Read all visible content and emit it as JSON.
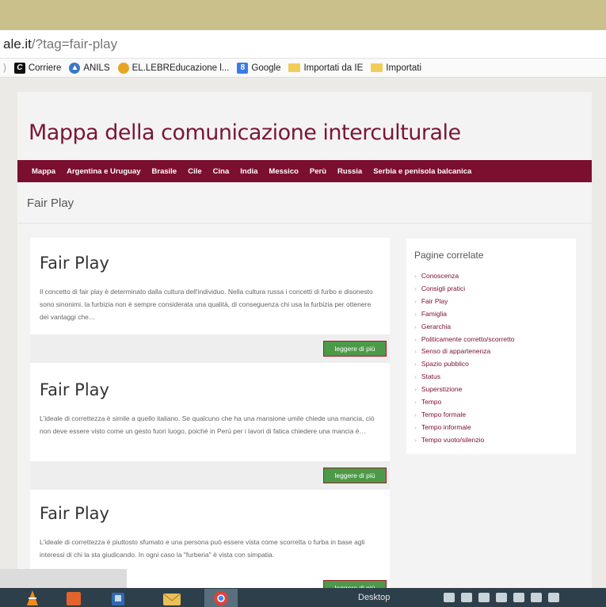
{
  "browser": {
    "url_host": "ale.it",
    "url_rest": "/?tag=fair-play",
    "bookmarks": [
      {
        "label": "Corriere",
        "icon": "corriere-icon"
      },
      {
        "label": "ANILS",
        "icon": "anils-icon"
      },
      {
        "label": "EL.LEBREducazione l...",
        "icon": "globe-icon"
      },
      {
        "label": "Google",
        "icon": "google-icon"
      },
      {
        "label": "Importati da IE",
        "icon": "folder-icon"
      },
      {
        "label": "Importati",
        "icon": "folder-icon"
      }
    ]
  },
  "site": {
    "title": "Mappa della comunicazione interculturale",
    "nav": [
      "Mappa",
      "Argentina e Uruguay",
      "Brasile",
      "Cile",
      "Cina",
      "India",
      "Messico",
      "Perù",
      "Russia",
      "Serbia e penisola balcanica"
    ],
    "breadcrumb": "Fair Play"
  },
  "posts": [
    {
      "title": "Fair Play",
      "excerpt": "Il concetto di fair play è determinato dalla cultura dell'individuo. Nella cultura russa i concetti di furbo e disonesto sono sinonimi. la furbizia non è sempre considerata una qualità, di conseguenza chi usa la furbizia per ottenere dei vantaggi che…",
      "button": "leggere di più"
    },
    {
      "title": "Fair Play",
      "excerpt": "L'ideale di correttezza è simile a quello italiano. Se qualcuno che ha una mansione umile chiede una mancia, ciò non deve essere visto come un gesto fuori luogo, poiché in Perù per i lavori di fatica chiedere una mancia è…",
      "button": "leggere di più"
    },
    {
      "title": "Fair Play",
      "excerpt": "L'ideale di correttezza è piuttosto sfumato e una persona può essere vista come scorretta o furba in base agli interessi di chi la sta giudicando. In ogni caso la \"furberia\" è vista con simpatia.",
      "button": "leggere di più"
    }
  ],
  "sidebar": {
    "title": "Pagine correlate",
    "items": [
      "Conoscenza",
      "Consigli pratici",
      "Fair Play",
      "Famiglia",
      "Gerarchia",
      "Politicamente corretto/scorretto",
      "Senso di appartenenza",
      "Spazio pubblico",
      "Status",
      "Superstizione",
      "Tempo",
      "Tempo formale",
      "Tempo informale",
      "Tempo vuoto/silenzio"
    ]
  },
  "taskbar": {
    "desktop_label": "Desktop",
    "apps": [
      "vlc-icon",
      "office-icon",
      "explorer-icon",
      "mail-icon",
      "chrome-icon"
    ]
  }
}
